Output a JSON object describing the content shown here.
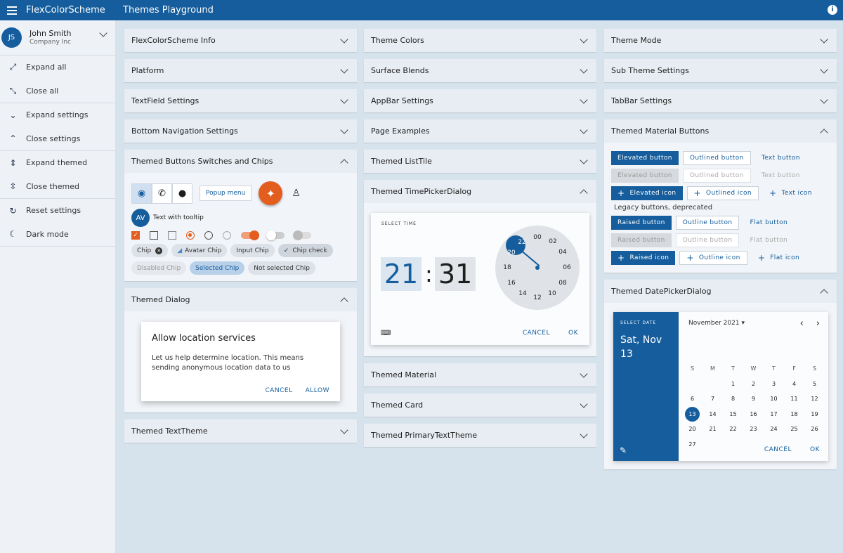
{
  "appbar": {
    "title": "FlexColorScheme",
    "page_title": "Themes Playground",
    "info_icon": "i"
  },
  "drawer": {
    "user": {
      "initials": "JS",
      "name": "John Smith",
      "company": "Company Inc"
    },
    "groups": [
      [
        {
          "icon": "⤢",
          "label": "Expand all"
        },
        {
          "icon": "⤡",
          "label": "Close all"
        }
      ],
      [
        {
          "icon": "⌄",
          "label": "Expand settings"
        },
        {
          "icon": "⌃",
          "label": "Close settings"
        }
      ],
      [
        {
          "icon": "⇕",
          "label": "Expand themed"
        },
        {
          "icon": "⇳",
          "label": "Close themed"
        }
      ],
      [
        {
          "icon": "↻",
          "label": "Reset settings"
        },
        {
          "icon": "☾",
          "label": "Dark mode"
        }
      ]
    ]
  },
  "col1": {
    "p1": "FlexColorScheme Info",
    "p2": "Platform",
    "p3": "TextField Settings",
    "p4": "Bottom Navigation Settings",
    "p5": "Themed Buttons Switches and Chips",
    "p6": "Themed Dialog",
    "p7": "Themed TextTheme"
  },
  "buttons_panel": {
    "popup_menu": "Popup menu",
    "avatar": "AV",
    "tooltip_text": "Text with tooltip",
    "chips_row1": [
      "Chip",
      "Avatar Chip",
      "Input Chip",
      "Chip check"
    ],
    "chips_row2": [
      "Disabled Chip",
      "Selected Chip",
      "Not selected Chip"
    ]
  },
  "dialog": {
    "title": "Allow location services",
    "body": "Let us help determine location. This means sending anonymous location data to us",
    "cancel": "CANCEL",
    "allow": "ALLOW"
  },
  "col2": {
    "p1": "Theme Colors",
    "p2": "Surface Blends",
    "p3": "AppBar Settings",
    "p4": "Page Examples",
    "p5": "Themed ListTile",
    "p6": "Themed TimePickerDialog",
    "p7": "Themed Material",
    "p8": "Themed Card",
    "p9": "Themed PrimaryTextTheme"
  },
  "timepicker": {
    "label": "SELECT TIME",
    "hour": "21",
    "colon": ":",
    "minute": "31",
    "dial": [
      "00",
      "04",
      "06",
      "08",
      "10",
      "12",
      "14",
      "16",
      "18",
      "20",
      "22",
      "02"
    ],
    "cancel": "CANCEL",
    "ok": "OK"
  },
  "col3": {
    "p1": "Theme Mode",
    "p2": "Sub Theme Settings",
    "p3": "TabBar Settings",
    "p4": "Themed Material Buttons",
    "p5": "Themed DatePickerDialog"
  },
  "material_buttons": {
    "row1": [
      "Elevated button",
      "Outlined button",
      "Text button"
    ],
    "row2": [
      "Elevated button",
      "Outlined button",
      "Text button"
    ],
    "row3": [
      "Elevated icon",
      "Outlined icon",
      "Text icon"
    ],
    "legacy": "Legacy buttons, deprecated",
    "row4": [
      "Raised button",
      "Outline button",
      "Flat button"
    ],
    "row5": [
      "Raised button",
      "Outline button",
      "Flat button"
    ],
    "row6": [
      "Raised icon",
      "Outline icon",
      "Flat icon"
    ]
  },
  "datepicker": {
    "label": "SELECT DATE",
    "selected": "Sat, Nov 13",
    "month": "November 2021",
    "weekdays": [
      "S",
      "M",
      "T",
      "W",
      "T",
      "F",
      "S"
    ],
    "days": [
      "",
      "",
      "1",
      "2",
      "3",
      "4",
      "5",
      "6",
      "7",
      "8",
      "9",
      "10",
      "11",
      "12",
      "13",
      "14",
      "15",
      "16",
      "17",
      "18",
      "19",
      "20",
      "21",
      "22",
      "23",
      "24",
      "25",
      "26",
      "27"
    ],
    "today": "13",
    "cancel": "CANCEL",
    "ok": "OK"
  },
  "colors": {
    "primary": "#155d9c",
    "secondary": "#e35d1f",
    "background": "#d7e3ec"
  }
}
